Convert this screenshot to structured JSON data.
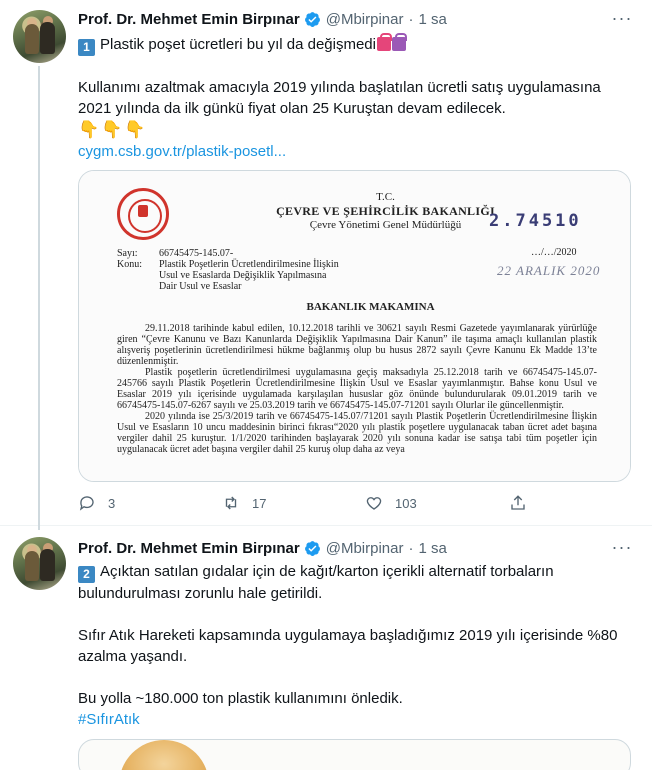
{
  "tweets": [
    {
      "author_name": "Prof. Dr. Mehmet Emin Birpınar",
      "handle": "@Mbirpinar",
      "separator": "·",
      "time": "1 sa",
      "number_badge": "1",
      "headline": "Plastik poşet ücretleri bu yıl da değişmedi",
      "paragraph": "Kullanımı azaltmak amacıyla 2019 yılında başlatılan ücretli satış uygulamasına 2021 yılında da ilk günkü fiyat olan 25 Kuruştan devam edilecek.",
      "link": "cygm.csb.gov.tr/plastik-posetl...",
      "reply_count": "3",
      "retweet_count": "17",
      "like_count": "103",
      "document": {
        "tc": "T.C.",
        "ministry": "ÇEVRE VE ŞEHİRCİLİK BAKANLIĞI",
        "directorate": "Çevre Yönetimi Genel Müdürlüğü",
        "stamp_number": "2.74510",
        "date_template": "…/…/2020",
        "date_stamp": "22 ARALIK 2020",
        "sayi_label": "Sayı:",
        "sayi_value": "66745475-145.07-",
        "konu_label": "Konu:",
        "konu_line1": "Plastik Poşetlerin Ücretlendirilmesine İlişkin",
        "konu_line2": "Usul ve Esaslarda Değişiklik Yapılmasına",
        "konu_line3": "Dair Usul ve Esaslar",
        "makam": "BAKANLIK MAKAMINA",
        "body_p1": "29.11.2018 tarihinde kabul edilen, 10.12.2018 tarihli ve 30621 sayılı Resmi Gazetede yayımlanarak yürürlüğe giren “Çevre Kanunu ve Bazı Kanunlarda Değişiklik Yapılmasına Dair Kanun” ile taşıma amaçlı kullanılan plastik alışveriş poşetlerinin ücretlendirilmesi hükme bağlanmış olup bu husus 2872 sayılı Çevre Kanunu Ek Madde 13’te düzenlenmiştir.",
        "body_p2": "Plastik poşetlerin ücretlendirilmesi uygulamasına geçiş maksadıyla 25.12.2018 tarih ve 66745475-145.07-245766 sayılı Plastik Poşetlerin Ücretlendirilmesine İlişkin Usul ve Esaslar yayımlanmıştır. Bahse konu Usul ve Esaslar 2019 yılı içerisinde uygulamada karşılaşılan hususlar göz önünde bulundurularak 09.01.2019 tarih ve 66745475-145.07-6267 sayılı ve 25.03.2019 tarih ve 66745475-145.07-71201 sayılı Olurlar ile güncellenmiştir.",
        "body_p3": "2020 yılında ise 25/3/2019 tarih ve 66745475-145.07/71201 sayılı Plastik Poşetlerin Ücretlendirilmesine İlişkin Usul ve Esasların 10 uncu maddesinin birinci fıkrası“2020 yılı plastik poşetlere uygulanacak taban ücret adet başına vergiler dahil 25 kuruştur. 1/1/2020 tarihinden başlayarak 2020 yılı sonuna kadar ise satışa tabi tüm poşetler için uygulanacak ücret adet başına vergiler dahil 25 kuruş olup daha az veya"
      }
    },
    {
      "author_name": "Prof. Dr. Mehmet Emin Birpınar",
      "handle": "@Mbirpinar",
      "separator": "·",
      "time": "1 sa",
      "number_badge": "2",
      "paragraph1": "Açıktan satılan gıdalar için de kağıt/karton içerikli alternatif torbaların bulundurulması zorunlu hale getirildi.",
      "paragraph2": "Sıfır Atık Hareketi kapsamında uygulamaya başladığımız 2019 yılı içerisinde %80 azalma yaşandı.",
      "paragraph3": "Bu yolla ~180.000 ton plastik kullanımını önledik.",
      "hashtag": "#SıfırAtık"
    }
  ],
  "colors": {
    "link": "#1b95e0",
    "verified": "#1d9bf0",
    "muted": "#536471",
    "seal": "#d0342c"
  },
  "icons": {
    "verified": "verified-badge-icon",
    "reply": "reply-icon",
    "retweet": "retweet-icon",
    "like": "heart-icon",
    "share": "share-icon",
    "more": "more-dots-icon",
    "pointing": "backhand-pointing-down-emoji",
    "bags": "shopping-bags-emoji"
  }
}
